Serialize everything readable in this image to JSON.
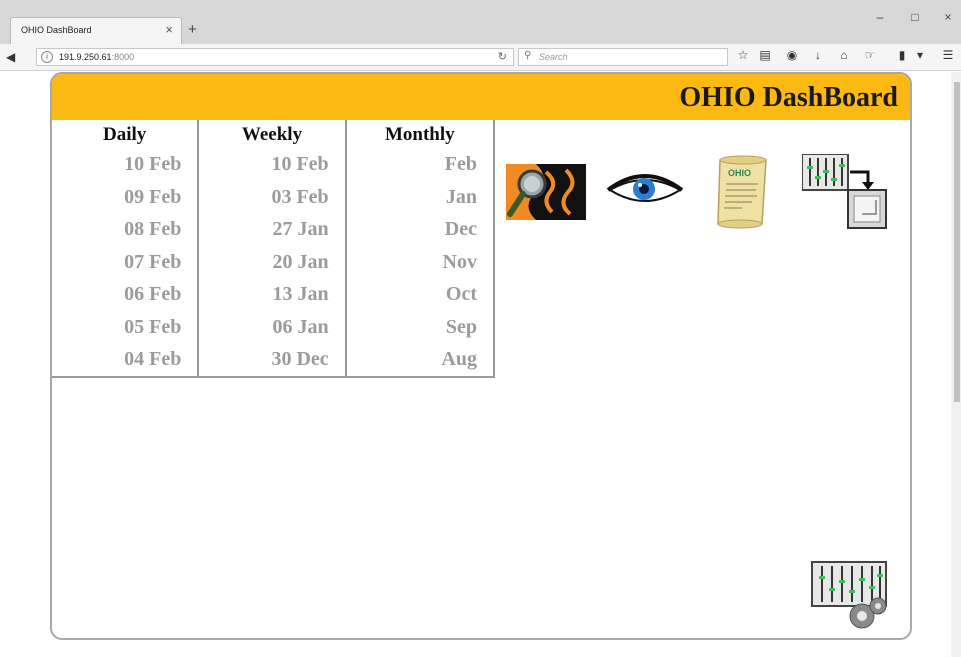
{
  "browser": {
    "tab_title": "OHIO DashBoard",
    "tab_close": "×",
    "new_tab": "+",
    "url_host": "191.9.250.61",
    "url_port": ":8000",
    "search_placeholder": "Search",
    "window_buttons": [
      "–",
      "□",
      "×"
    ]
  },
  "dashboard": {
    "title": "OHIO DashBoard",
    "columns": [
      {
        "header": "Daily",
        "items": [
          "10 Feb",
          "09 Feb",
          "08 Feb",
          "07 Feb",
          "06 Feb",
          "05 Feb",
          "04 Feb"
        ]
      },
      {
        "header": "Weekly",
        "items": [
          "10 Feb",
          "03 Feb",
          "27 Jan",
          "20 Jan",
          "13 Jan",
          "06 Jan",
          "30 Dec"
        ]
      },
      {
        "header": "Monthly",
        "items": [
          "Feb",
          "Jan",
          "Dec",
          "Nov",
          "Oct",
          "Sep",
          "Aug"
        ]
      }
    ],
    "tools": [
      {
        "icon": "magnifier-tool-icon"
      },
      {
        "icon": "eye-view-icon"
      },
      {
        "icon": "ohio-scroll-icon",
        "label": "OHIO"
      },
      {
        "icon": "equalizer-save-icon"
      },
      {
        "icon": "equalizer-settings-icon"
      }
    ],
    "colors": {
      "header": "#fdb913",
      "date_text": "#9b9b9b",
      "border": "#a8a8a8"
    }
  }
}
